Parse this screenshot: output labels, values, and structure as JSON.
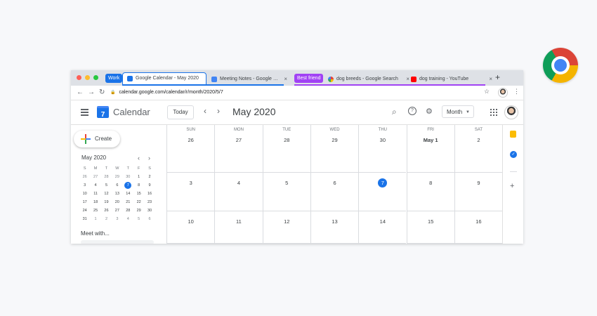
{
  "browser": {
    "tab_groups": [
      {
        "label": "Work",
        "color": "#1a73e8"
      },
      {
        "label": "Best friend",
        "color": "#a142f4"
      }
    ],
    "tabs": [
      {
        "title": "Google Calendar - May 2020",
        "active": true
      },
      {
        "title": "Meeting Notes - Google Docs"
      },
      {
        "title": "dog breeds - Google Search"
      },
      {
        "title": "dog training - YouTube"
      }
    ],
    "close_glyph": "×",
    "new_tab_glyph": "+",
    "url": "calendar.google.com/calendar/r/month/2020/5/7"
  },
  "calendar": {
    "app_title": "Calendar",
    "logo_day": "7",
    "today_label": "Today",
    "month_title": "May 2020",
    "view_label": "Month",
    "create_label": "Create",
    "meet_label": "Meet with...",
    "weekdays": [
      "SUN",
      "MON",
      "TUE",
      "WED",
      "THU",
      "FRI",
      "SAT"
    ],
    "rows": [
      [
        "26",
        "27",
        "28",
        "29",
        "30",
        "May 1",
        "2"
      ],
      [
        "3",
        "4",
        "5",
        "6",
        "7",
        "8",
        "9"
      ],
      [
        "10",
        "11",
        "12",
        "13",
        "14",
        "15",
        "16"
      ]
    ],
    "today_cell": [
      1,
      4
    ],
    "mini": {
      "title": "May 2020",
      "headers": [
        "S",
        "M",
        "T",
        "W",
        "T",
        "F",
        "S"
      ],
      "weeks": [
        [
          "26",
          "27",
          "28",
          "29",
          "30",
          "1",
          "2"
        ],
        [
          "3",
          "4",
          "5",
          "6",
          "7",
          "8",
          "9"
        ],
        [
          "10",
          "11",
          "12",
          "13",
          "14",
          "15",
          "16"
        ],
        [
          "17",
          "18",
          "19",
          "20",
          "21",
          "22",
          "23"
        ],
        [
          "24",
          "25",
          "26",
          "27",
          "28",
          "29",
          "30"
        ],
        [
          "31",
          "1",
          "2",
          "3",
          "4",
          "5",
          "6"
        ]
      ],
      "selected": "7"
    }
  },
  "icons": {
    "back": "←",
    "forward": "→",
    "reload": "↻",
    "lock": "🔒",
    "star": "☆",
    "menu_dots": "⋮",
    "prev": "‹",
    "next": "›",
    "search": "⌕",
    "help": "?",
    "settings": "⚙",
    "dropdown": "▼",
    "plus": "+",
    "check": "✓"
  }
}
